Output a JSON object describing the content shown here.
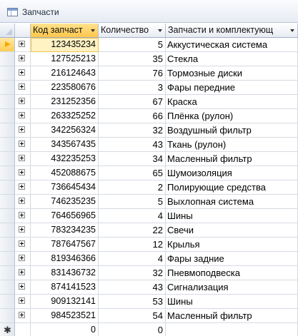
{
  "window": {
    "title": "Запчасти"
  },
  "columns": {
    "col1": "Код запчаст",
    "col2": "Количество",
    "col3": "Запчасти и комплектующ"
  },
  "rows": [
    {
      "code": "123435234",
      "qty": "5",
      "name": "Аккустическая система"
    },
    {
      "code": "127525213",
      "qty": "35",
      "name": "Стекла"
    },
    {
      "code": "216124643",
      "qty": "76",
      "name": "Тормозные диски"
    },
    {
      "code": "223580676",
      "qty": "3",
      "name": "Фары передние"
    },
    {
      "code": "231252356",
      "qty": "67",
      "name": "Краска"
    },
    {
      "code": "263325252",
      "qty": "66",
      "name": "Плёнка (рулон)"
    },
    {
      "code": "342256324",
      "qty": "32",
      "name": "Воздушный фильтр"
    },
    {
      "code": "343567435",
      "qty": "43",
      "name": "Ткань (рулон)"
    },
    {
      "code": "432235253",
      "qty": "34",
      "name": "Масленный фильтр"
    },
    {
      "code": "452088675",
      "qty": "65",
      "name": "Шумоизоляция"
    },
    {
      "code": "736645434",
      "qty": "2",
      "name": "Полирующие средства"
    },
    {
      "code": "746235235",
      "qty": "5",
      "name": "Выхлопная система"
    },
    {
      "code": "764656965",
      "qty": "4",
      "name": "Шины"
    },
    {
      "code": "783234235",
      "qty": "22",
      "name": "Свечи"
    },
    {
      "code": "787647567",
      "qty": "12",
      "name": "Крылья"
    },
    {
      "code": "819346366",
      "qty": "4",
      "name": "Фары задние"
    },
    {
      "code": "831436732",
      "qty": "32",
      "name": "Пневмоподвеска"
    },
    {
      "code": "874141523",
      "qty": "43",
      "name": "Сигнализация"
    },
    {
      "code": "909132141",
      "qty": "53",
      "name": "Шины"
    },
    {
      "code": "984523521",
      "qty": "54",
      "name": "Масленный фильтр"
    }
  ],
  "new_row": {
    "code": "0",
    "qty": "0",
    "name": ""
  },
  "current_row_index": 0
}
